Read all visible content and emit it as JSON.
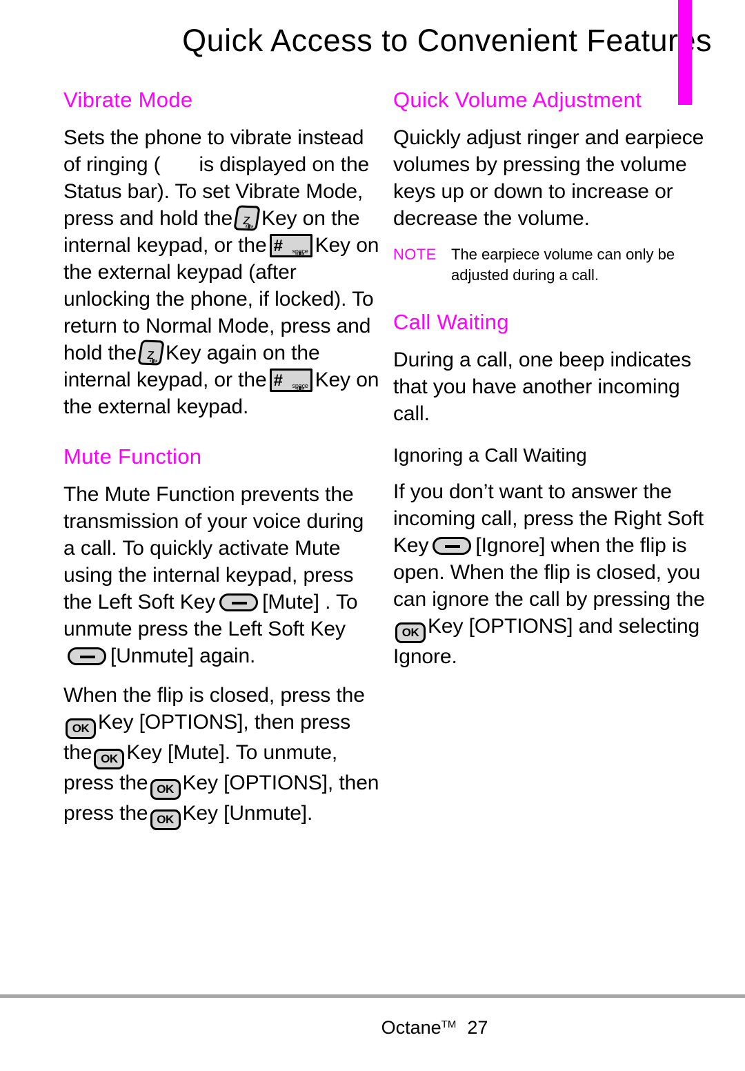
{
  "header": {
    "title": "Quick Access to Convenient Features",
    "accent_color": "#ff00ff"
  },
  "left_column": {
    "sections": [
      {
        "heading": "Vibrate Mode",
        "paragraphs": [
          {
            "runs": [
              {
                "type": "text",
                "text": "Sets the phone to vibrate instead of ringing ("
              },
              {
                "type": "icon",
                "icon": "vibrate-status-icon-missing"
              },
              {
                "type": "text",
                "text": "is displayed on the Status bar). To set Vibrate Mode, press and hold the"
              },
              {
                "type": "icon",
                "icon": "vibrate-z-key-icon"
              },
              {
                "type": "text",
                "text": "Key on the internal keypad, or the"
              },
              {
                "type": "icon",
                "icon": "hash-space-key-icon"
              },
              {
                "type": "text",
                "text": "Key on the external keypad (after unlocking the phone, if locked). To return to Normal Mode, press and hold the"
              },
              {
                "type": "icon",
                "icon": "vibrate-z-key-icon"
              },
              {
                "type": "text",
                "text": "Key again on the internal keypad, or the"
              },
              {
                "type": "icon",
                "icon": "hash-space-key-icon"
              },
              {
                "type": "text",
                "text": "Key on the external keypad."
              }
            ]
          }
        ]
      },
      {
        "heading": "Mute Function",
        "paragraphs": [
          {
            "runs": [
              {
                "type": "text",
                "text": "The Mute Function prevents the transmission of your voice during a call. To quickly activate Mute using the internal keypad, press the Left Soft Key"
              },
              {
                "type": "icon",
                "icon": "soft-key-icon"
              },
              {
                "type": "text",
                "text": "[Mute] . To unmute press the Left Soft Key"
              },
              {
                "type": "icon",
                "icon": "soft-key-icon"
              },
              {
                "type": "text",
                "text": "[Unmute] again."
              }
            ]
          },
          {
            "runs": [
              {
                "type": "text",
                "text": "When the flip is closed, press the"
              },
              {
                "type": "icon",
                "icon": "ok-key-icon"
              },
              {
                "type": "text",
                "text": "Key [OPTIONS], then press the"
              },
              {
                "type": "icon",
                "icon": "ok-key-icon"
              },
              {
                "type": "text",
                "text": "Key [Mute]. To unmute, press the"
              },
              {
                "type": "icon",
                "icon": "ok-key-icon"
              },
              {
                "type": "text",
                "text": "Key [OPTIONS], then press the"
              },
              {
                "type": "icon",
                "icon": "ok-key-icon"
              },
              {
                "type": "text",
                "text": "Key [Unmute]."
              }
            ]
          }
        ]
      }
    ]
  },
  "right_column": {
    "sections": [
      {
        "heading": "Quick Volume Adjustment",
        "paragraphs": [
          {
            "runs": [
              {
                "type": "text",
                "text": "Quickly adjust ringer and earpiece volumes by pressing the volume keys up or down to increase or decrease the volume."
              }
            ]
          }
        ],
        "note": {
          "label": "NOTE",
          "text": "The earpiece volume can only be adjusted during a call."
        }
      },
      {
        "heading": "Call Waiting",
        "paragraphs": [
          {
            "runs": [
              {
                "type": "text",
                "text": "During a call, one beep indicates that you have another incoming call."
              }
            ]
          }
        ],
        "subheading": "Ignoring a Call Waiting",
        "sub_paragraphs": [
          {
            "runs": [
              {
                "type": "text",
                "text": "If you don’t want to answer the incoming call, press the Right Soft Key"
              },
              {
                "type": "icon",
                "icon": "soft-key-icon"
              },
              {
                "type": "text",
                "text": "[Ignore] when the flip is open. When the flip is closed, you can ignore the call by pressing the"
              },
              {
                "type": "icon",
                "icon": "ok-key-icon"
              },
              {
                "type": "text",
                "text": "Key [OPTIONS] and selecting Ignore."
              }
            ]
          }
        ]
      }
    ]
  },
  "icons": {
    "ok-key-icon": {
      "label": "OK"
    },
    "soft-key-icon": {
      "label": ""
    },
    "vibrate-z-key-icon": {
      "label": "z"
    },
    "hash-space-key-icon": {
      "hash": "#",
      "space": "space"
    }
  },
  "footer": {
    "product": "Octane",
    "trademark": "TM",
    "page_number": "27"
  }
}
